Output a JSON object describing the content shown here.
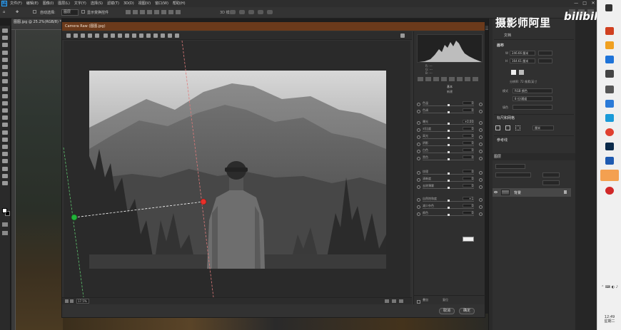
{
  "menubar": {
    "app_icon": "Ps",
    "items": [
      "文件(F)",
      "编辑(E)",
      "图像(I)",
      "图层(L)",
      "文字(Y)",
      "选择(S)",
      "滤镜(T)",
      "3D(D)",
      "视图(V)",
      "窗口(W)",
      "帮助(H)"
    ],
    "window_controls": [
      "—",
      "□",
      "✕"
    ]
  },
  "options_bar": {
    "auto_select_label": "自动选择:",
    "auto_select_value": "图层",
    "show_transform_label": "显示变换控件",
    "mode_3d_label": "3D 模式:"
  },
  "document": {
    "tab_title": "图图.jpg @ 25.2%(RGB/8) *"
  },
  "camera_raw": {
    "title": "Camera Raw (图图.jpg)",
    "panel_title": "基本",
    "mode_label": "新建",
    "zoom_value": "17.5%",
    "sliders": [
      {
        "label": "色温",
        "value": "0",
        "pos": 0.5
      },
      {
        "label": "色调",
        "value": "0",
        "pos": 0.5
      },
      {
        "label": "曝光",
        "value": "+0.00",
        "pos": 0.5
      },
      {
        "label": "对比度",
        "value": "0",
        "pos": 0.5
      },
      {
        "label": "高光",
        "value": "0",
        "pos": 0.5
      },
      {
        "label": "阴影",
        "value": "0",
        "pos": 0.5
      },
      {
        "label": "白色",
        "value": "0",
        "pos": 0.5
      },
      {
        "label": "黑色",
        "value": "0",
        "pos": 0.5
      },
      {
        "label": "纹理",
        "value": "0",
        "pos": 0.5
      },
      {
        "label": "清晰度",
        "value": "0",
        "pos": 0.5
      },
      {
        "label": "去除薄雾",
        "value": "0",
        "pos": 0.5
      },
      {
        "label": "自然饱和度",
        "value": "+1",
        "pos": 0.5
      },
      {
        "label": "减少杂色",
        "value": "0",
        "pos": 0.5
      },
      {
        "label": "颜色",
        "value": "0",
        "pos": 0.5
      }
    ],
    "color_label": "颜色",
    "footer": {
      "cancel": "取消",
      "ok": "确定",
      "overlay_label": "叠加",
      "reset_label": "复位"
    }
  },
  "properties_panel": {
    "doc_label": "文档",
    "canvas_label": "画布",
    "width_label": "W",
    "width_value": "246.66 厘米",
    "height_label": "H",
    "height_value": "164.61 厘米",
    "resolution_label": "分辨率: 72 像素/英寸",
    "mode_label": "模式",
    "mode_value": "RGB 颜色",
    "depth_value": "8 位/通道",
    "fill_label": "填色",
    "ruler_section": "标尺和网格",
    "ruler_unit": "厘米",
    "guide_section": "参考线"
  },
  "layers_panel": {
    "tab_label": "图层",
    "layer_name": "背景"
  },
  "watermark": {
    "text": "摄影师阿里",
    "brand": "bilibili"
  },
  "taskbar": {
    "time": "12:49",
    "day": "星期二"
  }
}
